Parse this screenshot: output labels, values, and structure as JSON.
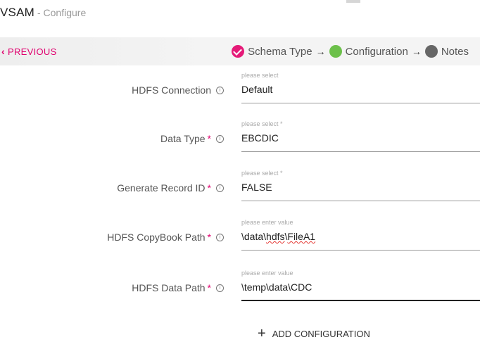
{
  "header": {
    "title": "VSAM",
    "subtitle": "- Configure"
  },
  "stepbar": {
    "previous_label": "PREVIOUS",
    "steps": [
      {
        "label": "Schema Type",
        "status": "done",
        "color": "#e51a78"
      },
      {
        "label": "Configuration",
        "status": "current",
        "color": "#6cc04a"
      },
      {
        "label": "Notes",
        "status": "todo",
        "color": "#666666"
      }
    ],
    "arrow": "→"
  },
  "fields": [
    {
      "label": "HDFS Connection",
      "required": false,
      "placeholder": "please select",
      "value": "Default"
    },
    {
      "label": "Data Type",
      "required": true,
      "placeholder": "please select *",
      "value": "EBCDIC"
    },
    {
      "label": "Generate Record ID",
      "required": true,
      "placeholder": "please select *",
      "value": "FALSE"
    },
    {
      "label": "HDFS CopyBook Path",
      "required": true,
      "placeholder": "please enter value",
      "value_parts": [
        "\\data\\",
        "hdfs",
        "\\",
        "FileA1"
      ]
    },
    {
      "label": "HDFS Data Path",
      "required": true,
      "placeholder": "please enter value",
      "value": "\\temp\\data\\CDC"
    }
  ],
  "required_mark": "*",
  "info_glyph": "i",
  "add_config": {
    "label": "ADD CONFIGURATION",
    "icon": "plus-icon"
  },
  "colors": {
    "accent": "#e0006e"
  }
}
